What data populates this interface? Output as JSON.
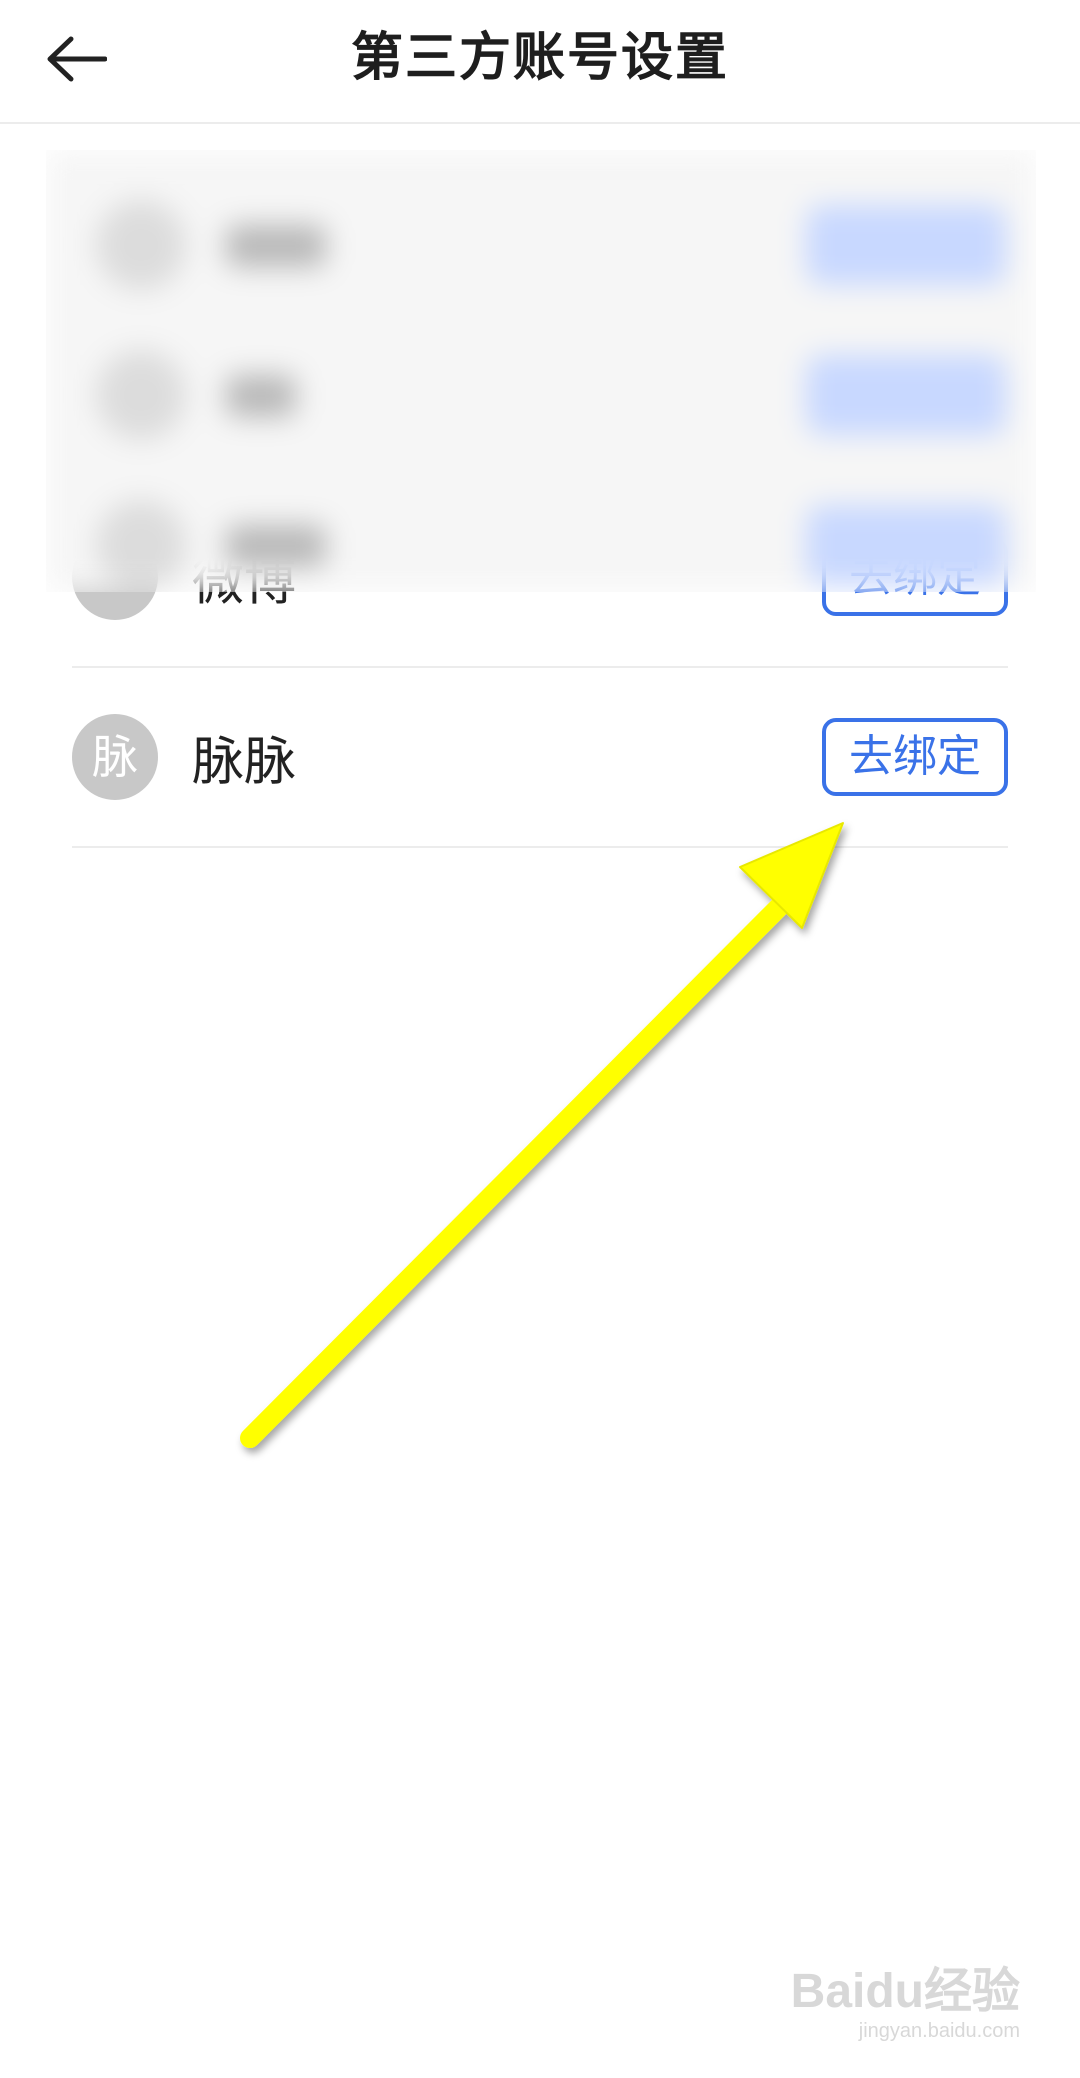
{
  "header": {
    "title": "第三方账号设置",
    "back_icon": "arrow-left-icon"
  },
  "accounts": [
    {
      "avatar_glyph": "",
      "name": "微博",
      "action_label": "去绑定",
      "obscured": true
    },
    {
      "avatar_glyph": "脉",
      "name": "脉脉",
      "action_label": "去绑定",
      "obscured": false
    }
  ],
  "annotation": {
    "arrow_color": "#ffff00"
  },
  "watermark": {
    "main": "Baidu经验",
    "sub": "jingyan.baidu.com"
  },
  "colors": {
    "accent": "#3a72e8",
    "avatar_bg": "#c8c8c8",
    "divider": "#ececec"
  }
}
